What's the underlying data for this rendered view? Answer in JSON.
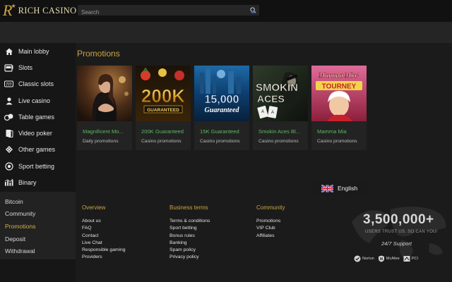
{
  "brand": {
    "logo_mark": "R",
    "name": "RICH CASINO"
  },
  "search": {
    "placeholder": "Search"
  },
  "sidebar": {
    "items": [
      {
        "label": "Main lobby",
        "icon": "home-icon"
      },
      {
        "label": "Slots",
        "icon": "slot-machine-icon"
      },
      {
        "label": "Classic slots",
        "icon": "777-icon"
      },
      {
        "label": "Live casino",
        "icon": "live-dealer-icon"
      },
      {
        "label": "Table games",
        "icon": "table-icon"
      },
      {
        "label": "Video poker",
        "icon": "cards-icon"
      },
      {
        "label": "Other games",
        "icon": "dice-icon"
      },
      {
        "label": "Sport betting",
        "icon": "ball-icon"
      },
      {
        "label": "Binary",
        "icon": "chart-icon"
      }
    ],
    "sub_items": [
      {
        "label": "Bitcoin"
      },
      {
        "label": "Community"
      },
      {
        "label": "Promotions"
      },
      {
        "label": "Deposit"
      },
      {
        "label": "Withdrawal"
      }
    ]
  },
  "main": {
    "title": "Promotions",
    "cards": [
      {
        "title": "Magnificent Mo...",
        "subtitle": "Daily promotions",
        "thumb_text": ""
      },
      {
        "title": "200K Guaranteed",
        "subtitle": "Casino promotions",
        "thumb_text": "200K",
        "thumb_sub": "GUARANTEED"
      },
      {
        "title": "15K Guaranteed",
        "subtitle": "Casino promotions",
        "thumb_text": "15,000",
        "thumb_sub": "Guaranteed"
      },
      {
        "title": "Smokin Aces Bl...",
        "subtitle": "Casino promotions",
        "thumb_text": "SMOKIN",
        "thumb_sub": "ACES"
      },
      {
        "title": "Mamma Mia",
        "subtitle": "Casino promotions",
        "thumb_text": "Mamma Mia!",
        "thumb_sub": "TOURNEY"
      }
    ]
  },
  "language": {
    "label": "English"
  },
  "footer": {
    "columns": [
      {
        "heading": "Overview",
        "links": [
          "About us",
          "FAQ",
          "Contact",
          "Live Chat",
          "Responsible gaming",
          "Providers"
        ]
      },
      {
        "heading": "Business terms",
        "links": [
          "Terms & conditions",
          "Sport betting",
          "Bonus rules",
          "Banking",
          "Spam policy",
          "Privacy policy"
        ]
      },
      {
        "heading": "Community",
        "links": [
          "Promotions",
          "VIP Club",
          "Affiliates"
        ]
      }
    ]
  },
  "trust": {
    "count": "3,500,000+",
    "tagline": "USERS TRUST US. SO CAN YOU!",
    "support": "24/7 Support",
    "badges": [
      "Norton",
      "McAfee",
      "PCI"
    ]
  },
  "colors": {
    "accent_gold": "#c9a641",
    "card_title_green": "#5bb85d",
    "background": "#1b1b1b"
  }
}
